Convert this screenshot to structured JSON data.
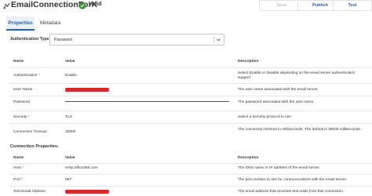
{
  "header": {
    "title": "EmailConnectionForK",
    "status": "Valid",
    "icon": "connection-icon",
    "status_icon": "check-circle-icon",
    "accent": "#1f5fbf",
    "valid_color": "#3a8f3a"
  },
  "toolbar": {
    "save_label": "Save",
    "publish_label": "Publish",
    "test_label": "Test"
  },
  "tabs": [
    {
      "label": "Properties",
      "active": true
    },
    {
      "label": "Metadata",
      "active": false
    }
  ],
  "auth_type": {
    "label": "Authentication Type:",
    "value": "Password"
  },
  "table_headers": {
    "name": "Name",
    "value": "Value",
    "description": "Description"
  },
  "auth_rows": [
    {
      "name": "Authentication",
      "required": true,
      "value": "Enable",
      "description": "Select Enable or Disable depending on the email server authentication support."
    },
    {
      "name": "User Name",
      "required": false,
      "value": "",
      "description": "The user name associated with the email server."
    },
    {
      "name": "Password",
      "required": false,
      "value": "",
      "description": "The password associated with the user name."
    },
    {
      "name": "Security",
      "required": true,
      "value": "TLS",
      "description": "Select a security protocol to use."
    },
    {
      "name": "Connection Timeout",
      "required": false,
      "value": "30000",
      "description": "The connection timeout in milliseconds. The default is 30000 milliseconds."
    }
  ],
  "connection_section": {
    "title": "Connection Properties:"
  },
  "connection_rows": [
    {
      "name": "Host",
      "required": true,
      "value": "smtp.office365.com",
      "description": "The DNS name or IP address of the email server."
    },
    {
      "name": "Port",
      "required": true,
      "value": "587",
      "description": "The port number to use for communications with the email server."
    },
    {
      "name": "Test Email Address",
      "required": false,
      "value": "",
      "description": "The email address that receives test mails from this connection."
    }
  ]
}
